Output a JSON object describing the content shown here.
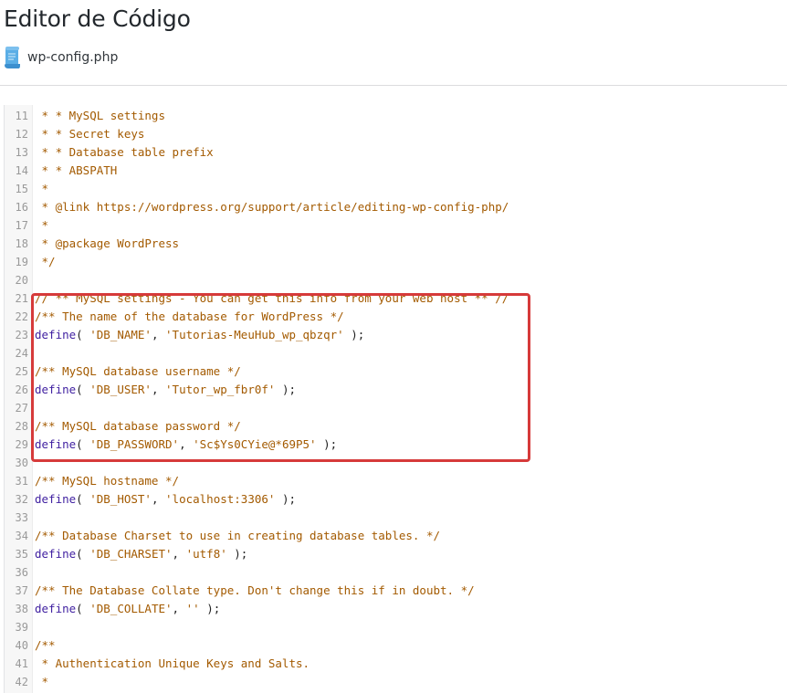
{
  "page": {
    "title": "Editor de Código",
    "file_name": "wp-config.php"
  },
  "editor": {
    "lines": [
      {
        "num": "11",
        "text": " * * MySQL settings"
      },
      {
        "num": "12",
        "text": " * * Secret keys"
      },
      {
        "num": "13",
        "text": " * * Database table prefix"
      },
      {
        "num": "14",
        "text": " * * ABSPATH"
      },
      {
        "num": "15",
        "text": " *"
      },
      {
        "num": "16",
        "text": " * @link https://wordpress.org/support/article/editing-wp-config-php/"
      },
      {
        "num": "17",
        "text": " *"
      },
      {
        "num": "18",
        "text": " * @package WordPress"
      },
      {
        "num": "19",
        "text": " */"
      },
      {
        "num": "20",
        "text": ""
      },
      {
        "num": "21",
        "text": "// ** MySQL settings - You can get this info from your web host ** //"
      },
      {
        "num": "22",
        "text": "/** The name of the database for WordPress */"
      },
      {
        "num": "23",
        "text": "define( 'DB_NAME', 'Tutorias-MeuHub_wp_qbzqr' );"
      },
      {
        "num": "24",
        "text": ""
      },
      {
        "num": "25",
        "text": "/** MySQL database username */"
      },
      {
        "num": "26",
        "text": "define( 'DB_USER', 'Tutor_wp_fbr0f' );"
      },
      {
        "num": "27",
        "text": ""
      },
      {
        "num": "28",
        "text": "/** MySQL database password */"
      },
      {
        "num": "29",
        "text": "define( 'DB_PASSWORD', 'Sc$Ys0CYie@*69P5' );"
      },
      {
        "num": "30",
        "text": ""
      },
      {
        "num": "31",
        "text": "/** MySQL hostname */"
      },
      {
        "num": "32",
        "text": "define( 'DB_HOST', 'localhost:3306' );"
      },
      {
        "num": "33",
        "text": ""
      },
      {
        "num": "34",
        "text": "/** Database Charset to use in creating database tables. */"
      },
      {
        "num": "35",
        "text": "define( 'DB_CHARSET', 'utf8' );"
      },
      {
        "num": "36",
        "text": ""
      },
      {
        "num": "37",
        "text": "/** The Database Collate type. Don't change this if in doubt. */"
      },
      {
        "num": "38",
        "text": "define( 'DB_COLLATE', '' );"
      },
      {
        "num": "39",
        "text": ""
      },
      {
        "num": "40",
        "text": "/**"
      },
      {
        "num": "41",
        "text": " * Authentication Unique Keys and Salts."
      },
      {
        "num": "42",
        "text": " *"
      }
    ]
  },
  "icons": {
    "file": "document-scroll-icon"
  },
  "colors": {
    "keyword": "#3f1fa0",
    "comment": "#a35a00",
    "string": "#a35a00",
    "highlight_border": "#d63a3a",
    "icon_blue": "#4fa3e0"
  }
}
